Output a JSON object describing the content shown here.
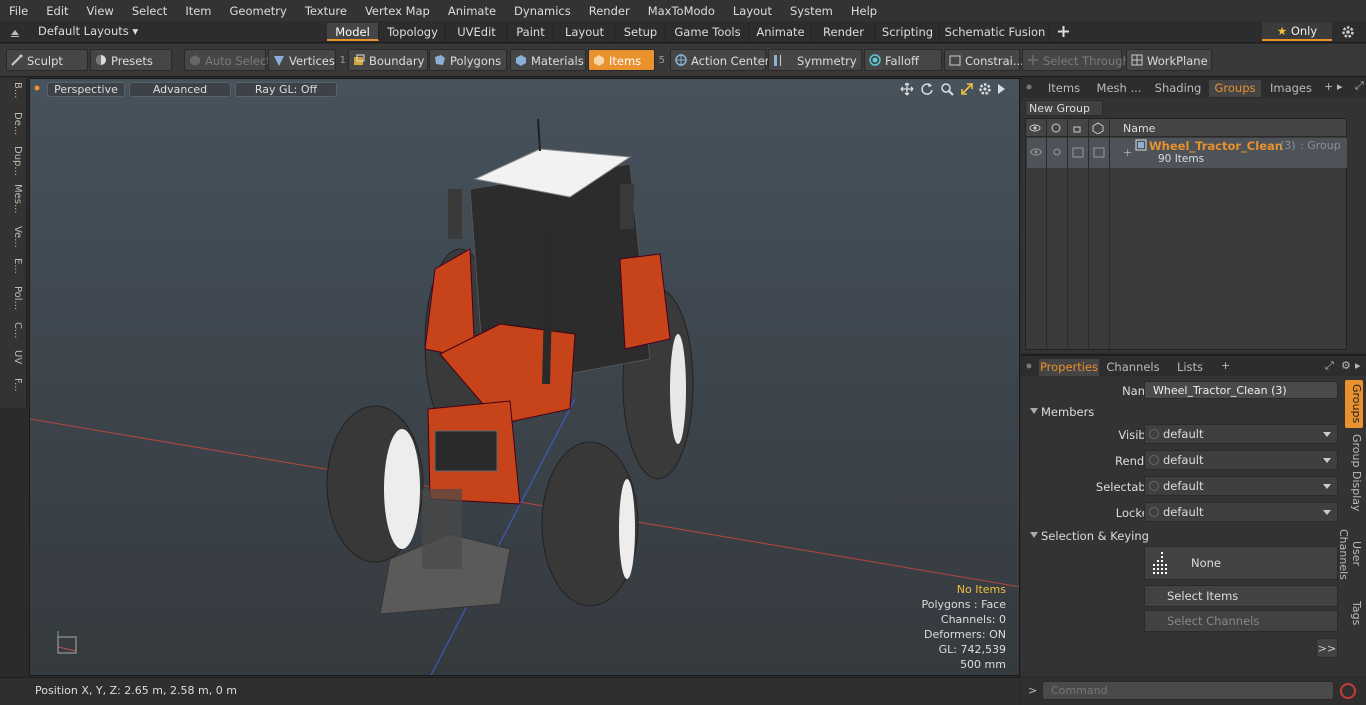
{
  "menu": [
    "File",
    "Edit",
    "View",
    "Select",
    "Item",
    "Geometry",
    "Texture",
    "Vertex Map",
    "Animate",
    "Dynamics",
    "Render",
    "MaxToModo",
    "Layout",
    "System",
    "Help"
  ],
  "layout_selector": "Default Layouts",
  "tabs": [
    "Model",
    "Topology",
    "UVEdit",
    "Paint",
    "Layout",
    "Setup",
    "Game Tools",
    "Animate",
    "Render",
    "Scripting",
    "Schematic Fusion"
  ],
  "active_tab": "Model",
  "only_label": "Only",
  "toolbar": {
    "sculpt": "Sculpt",
    "presets": "Presets",
    "auto_select": "Auto Select",
    "vertices": "Vertices",
    "vertices_count": "1",
    "boundary": "Boundary",
    "polygons": "Polygons",
    "materials": "Materials",
    "items": "Items",
    "items_count": "5",
    "action_center": "Action Center",
    "symmetry": "Symmetry",
    "falloff": "Falloff",
    "constraints": "Constrai...",
    "select_through": "Select Through",
    "workplane": "WorkPlane"
  },
  "left_tabs": [
    "B...",
    "De...",
    "Dup...",
    "Mes...",
    "Ve...",
    "E...",
    "Pol...",
    "C...",
    "UV",
    "F..."
  ],
  "viewport": {
    "perspective": "Perspective",
    "advanced": "Advanced",
    "raygl": "Ray GL: Off",
    "info": {
      "items": "No Items",
      "polygons": "Polygons : Face",
      "channels": "Channels: 0",
      "deformers": "Deformers: ON",
      "gl": "GL: 742,539",
      "scale": "500 mm"
    }
  },
  "status": {
    "position": "Position X, Y, Z:   2.65 m, 2.58 m, 0 m"
  },
  "right_tabs": [
    "Items",
    "Mesh ...",
    "Shading",
    "Groups",
    "Images"
  ],
  "active_right_tab": "Groups",
  "groups": {
    "new_group": "New Group",
    "name_header": "Name",
    "row_name": "Wheel_Tractor_Clean",
    "row_count": "(3)",
    "row_type": ": Group",
    "row_items": "90 Items"
  },
  "props_tabs": [
    "Properties",
    "Channels",
    "Lists"
  ],
  "props": {
    "name_label": "Name",
    "name_value": "Wheel_Tractor_Clean (3)",
    "members": "Members",
    "visible_label": "Visible",
    "visible_value": "default",
    "render_label": "Render",
    "render_value": "default",
    "selectable_label": "Selectable",
    "selectable_value": "default",
    "locked_label": "Locked",
    "locked_value": "default",
    "sel_keying": "Selection & Keying",
    "none": "None",
    "select_items": "Select Items",
    "select_channels": "Select Channels",
    "more": ">>"
  },
  "side_tabs": [
    "Groups",
    "Group Display",
    "User Channels",
    "Tags"
  ],
  "command": {
    "prompt": ">",
    "placeholder": "Command"
  },
  "colors": {
    "accent": "#e8912d",
    "group_name": "#e8912d",
    "tractor_body": "#c7431a"
  }
}
